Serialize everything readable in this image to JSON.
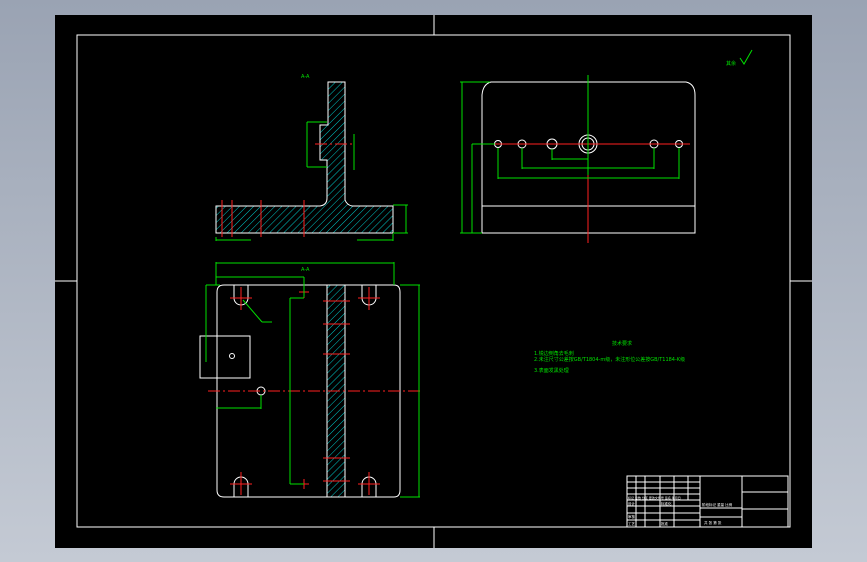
{
  "drawing": {
    "section_label": "A-A",
    "section_label_bottom": "A-A",
    "tech_requirements": {
      "title": "技术要求",
      "lines": [
        "1.锐边倒角去毛刺",
        "2.未注尺寸公差按GB/T1804-m级，未注形位公差按GB/T1184-K级",
        "3.表面发黑处理"
      ]
    },
    "roughness_note": "其余",
    "title_block": {
      "row1": "标记 处数 分区 更改文件号 签名 年月日",
      "row2": "设计",
      "row3": "审核",
      "row4": "工艺",
      "stage_label": "阶段标记 重量 比例",
      "sheet_label": "共 张 第 张",
      "std": "标准化",
      "approve": "批准"
    },
    "colors": {
      "sheet": "#000000",
      "outline": "#ffffff",
      "dimension": "#00e000",
      "centerline": "#ff2020",
      "hatch": "#00c8c8"
    }
  }
}
